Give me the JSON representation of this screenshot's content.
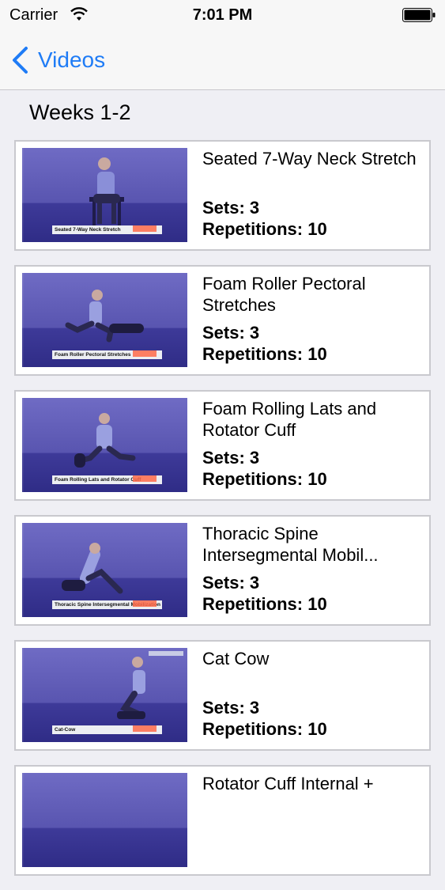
{
  "status_bar": {
    "carrier": "Carrier",
    "time": "7:01 PM"
  },
  "nav": {
    "back_label": "Videos"
  },
  "section": {
    "title": "Weeks 1-2"
  },
  "exercises": [
    {
      "title": "Seated 7-Way Neck Stretch",
      "caption": "Seated 7-Way Neck Stretch",
      "sets": "Sets: 3",
      "reps": "Repetitions: 10"
    },
    {
      "title": "Foam Roller Pectoral Stretches",
      "caption": "Foam Roller Pectoral Stretches",
      "sets": "Sets: 3",
      "reps": "Repetitions: 10"
    },
    {
      "title": "Foam Rolling Lats and Rotator Cuff",
      "caption": "Foam Rolling Lats and Rotator Cuff",
      "sets": "Sets: 3",
      "reps": "Repetitions: 10"
    },
    {
      "title": "Thoracic Spine Intersegmental Mobil...",
      "caption": "Thoracic Spine Intersegmental Mobilization",
      "sets": "Sets: 3",
      "reps": "Repetitions: 10"
    },
    {
      "title": "Cat Cow",
      "caption": "Cat-Cow",
      "sets": "Sets: 3",
      "reps": "Repetitions: 10"
    },
    {
      "title": "Rotator Cuff Internal +",
      "caption": "",
      "sets": "",
      "reps": ""
    }
  ]
}
